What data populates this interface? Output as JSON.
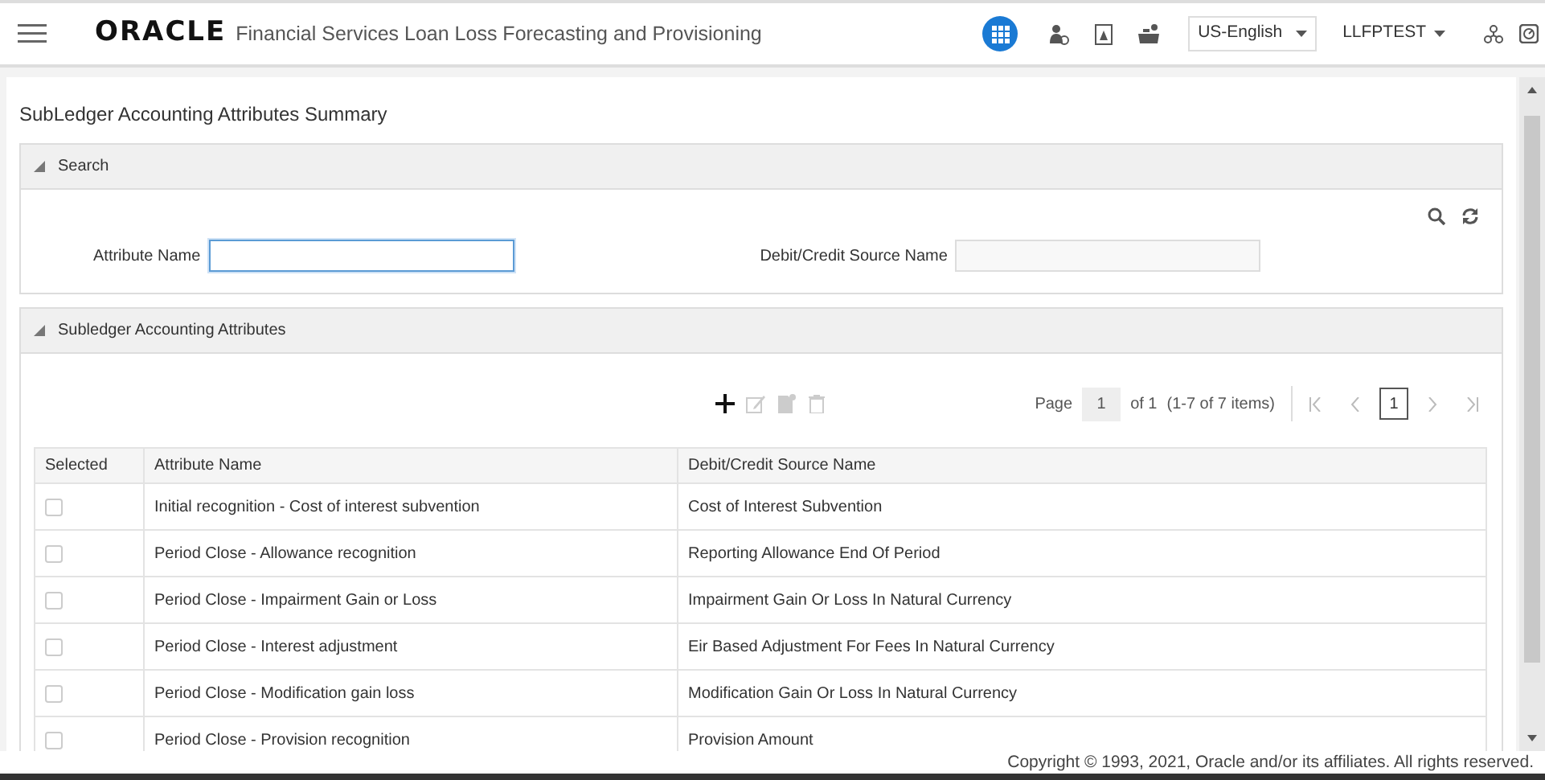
{
  "header": {
    "logo": "ORACLE",
    "app_title": "Financial Services Loan Loss Forecasting and Provisioning",
    "icons": [
      {
        "kind": "apps",
        "selected": true
      },
      {
        "kind": "user",
        "selected": false
      },
      {
        "kind": "document",
        "selected": false
      },
      {
        "kind": "tray",
        "selected": false
      }
    ],
    "language": "US-English",
    "user": "LLFPTEST"
  },
  "page_title": "SubLedger Accounting Attributes Summary",
  "search": {
    "title": "Search",
    "expanded": true,
    "fields": [
      {
        "label": "Attribute Name",
        "focused": true,
        "disabled": false
      },
      {
        "label": "Debit/Credit Source Name",
        "focused": false,
        "disabled": true
      }
    ]
  },
  "grid": {
    "title": "Subledger Accounting Attributes",
    "expanded": true,
    "toolbar": [
      {
        "kind": "add",
        "disabled": false
      },
      {
        "kind": "edit",
        "disabled": true
      },
      {
        "kind": "copy",
        "disabled": true
      },
      {
        "kind": "delete",
        "disabled": true
      }
    ],
    "pager": {
      "page_label": "Page",
      "page": "1",
      "of": "of 1",
      "items": "(1-7 of 7 items)",
      "current": "1"
    },
    "columns": [
      "Selected",
      "Attribute Name",
      "Debit/Credit Source Name"
    ],
    "rows": [
      {
        "checked": false,
        "attribute": "Initial recognition - Cost of interest subvention",
        "source": "Cost of Interest Subvention"
      },
      {
        "checked": false,
        "attribute": "Period Close - Allowance recognition",
        "source": "Reporting Allowance End Of Period"
      },
      {
        "checked": false,
        "attribute": "Period Close - Impairment Gain or Loss",
        "source": "Impairment Gain Or Loss In Natural Currency"
      },
      {
        "checked": false,
        "attribute": "Period Close - Interest adjustment",
        "source": "Eir Based Adjustment For Fees In Natural Currency"
      },
      {
        "checked": false,
        "attribute": "Period Close - Modification gain loss",
        "source": "Modification Gain Or Loss In Natural Currency"
      },
      {
        "checked": false,
        "attribute": "Period Close - Provision recognition",
        "source": "Provision Amount"
      }
    ]
  },
  "footer": "Copyright © 1993, 2021, Oracle and/or its affiliates. All rights reserved."
}
